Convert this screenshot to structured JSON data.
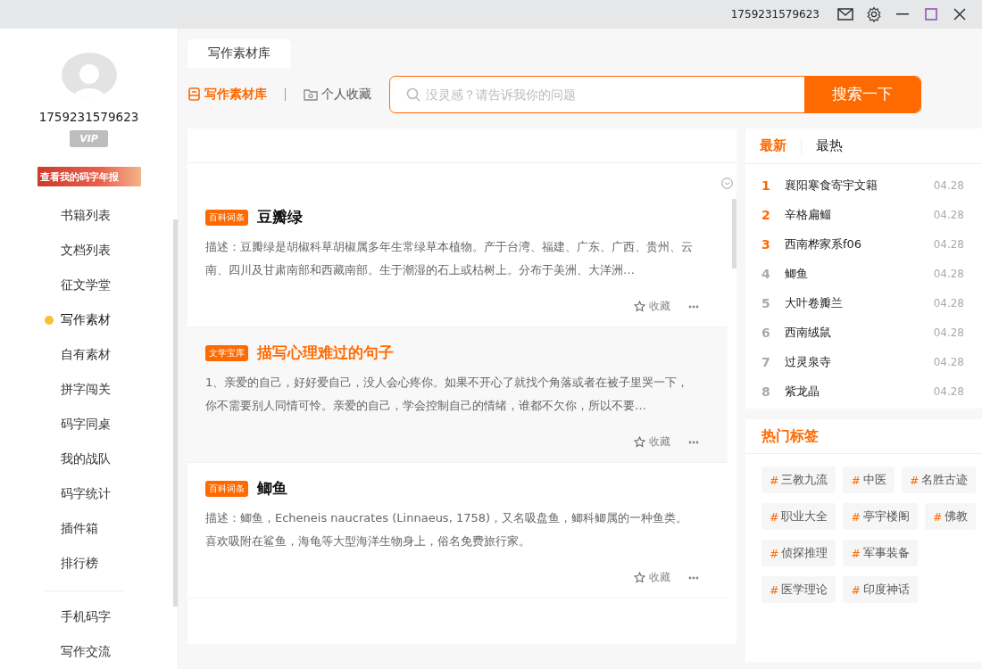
{
  "titlebar": {
    "account": "1759231579623"
  },
  "user": {
    "name": "1759231579623",
    "vip": "VIP",
    "report_banner": "查看我的码字年报"
  },
  "nav": [
    {
      "label": "书籍列表",
      "selected": false
    },
    {
      "label": "文档列表",
      "selected": false
    },
    {
      "label": "征文学堂",
      "selected": false
    },
    {
      "label": "写作素材",
      "selected": true
    },
    {
      "label": "自有素材",
      "selected": false
    },
    {
      "label": "拼字闯关",
      "selected": false
    },
    {
      "label": "码字同桌",
      "selected": false
    },
    {
      "label": "我的战队",
      "selected": false
    },
    {
      "label": "码字统计",
      "selected": false
    },
    {
      "label": "插件箱",
      "selected": false
    },
    {
      "label": "排行榜",
      "selected": false
    }
  ],
  "nav_extra": [
    {
      "label": "手机码字",
      "selected": false
    },
    {
      "label": "写作交流",
      "selected": false
    }
  ],
  "page_tab": "写作素材库",
  "sub_tabs": [
    {
      "label": "写作素材库",
      "selected": true,
      "kind": "library"
    },
    {
      "label": "个人收藏",
      "selected": false,
      "kind": "favorites"
    }
  ],
  "search": {
    "placeholder": "没灵感？请告诉我你的问题",
    "button": "搜索一下"
  },
  "articles": [
    {
      "tag": "百科词条",
      "title": "豆瓣绿",
      "highlighted": false,
      "description": "描述：豆瓣绿是胡椒科草胡椒属多年生常绿草本植物。产于台湾、福建、广东、广西、贵州、云南、四川及甘肃南部和西藏南部。生于潮湿的石上或枯树上。分布于美洲、大洋洲…",
      "favorite": "收藏"
    },
    {
      "tag": "文学宝库",
      "title": "描写心理难过的句子",
      "highlighted": true,
      "description": "1、亲爱的自己，好好爱自己，没人会心疼你。如果不开心了就找个角落或者在被子里哭一下，你不需要别人同情可怜。亲爱的自己，学会控制自己的情绪，谁都不欠你，所以不要…",
      "favorite": "收藏"
    },
    {
      "tag": "百科词条",
      "title": "鲫鱼",
      "highlighted": false,
      "description": "描述：鲫鱼，Echeneis naucrates (Linnaeus, 1758)，又名吸盘鱼，鲫科鲫属的一种鱼类。喜欢吸附在鲨鱼，海龟等大型海洋生物身上，俗名免费旅行家。",
      "favorite": "收藏"
    }
  ],
  "ranking": {
    "tabs": [
      {
        "label": "最新",
        "selected": true
      },
      {
        "label": "最热",
        "selected": false
      }
    ],
    "items": [
      {
        "rank": "1",
        "title": "襄阳寒食寄宇文籍",
        "date": "04.28",
        "top": true
      },
      {
        "rank": "2",
        "title": "辛格扁鲻",
        "date": "04.28",
        "top": true
      },
      {
        "rank": "3",
        "title": "西南桦家系f06",
        "date": "04.28",
        "top": true
      },
      {
        "rank": "4",
        "title": "鲫鱼",
        "date": "04.28",
        "top": false
      },
      {
        "rank": "5",
        "title": "大叶卷瓣兰",
        "date": "04.28",
        "top": false
      },
      {
        "rank": "6",
        "title": "西南绒鼠",
        "date": "04.28",
        "top": false
      },
      {
        "rank": "7",
        "title": "过灵泉寺",
        "date": "04.28",
        "top": false
      },
      {
        "rank": "8",
        "title": "紫龙晶",
        "date": "04.28",
        "top": false
      }
    ]
  },
  "hot_tags": {
    "title": "热门标签",
    "items": [
      {
        "hash": "#",
        "label": "三教九流"
      },
      {
        "hash": "#",
        "label": "中医"
      },
      {
        "hash": "#",
        "label": "名胜古迹"
      },
      {
        "hash": "#",
        "label": "职业大全"
      },
      {
        "hash": "#",
        "label": "亭宇楼阁"
      },
      {
        "hash": "#",
        "label": "佛教"
      },
      {
        "hash": "#",
        "label": "侦探推理"
      },
      {
        "hash": "#",
        "label": "军事装备"
      },
      {
        "hash": "#",
        "label": "医学理论"
      },
      {
        "hash": "#",
        "label": "印度神话"
      }
    ]
  }
}
